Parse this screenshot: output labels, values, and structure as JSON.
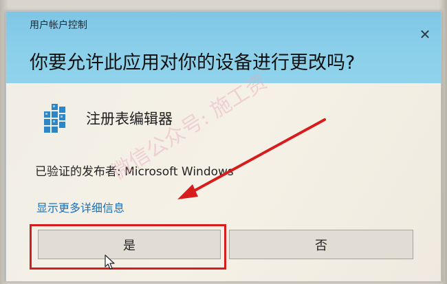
{
  "dialog": {
    "uac_title": "用户帐户控制",
    "close_symbol": "✕",
    "question": "你要允许此应用对你的设备进行更改吗?",
    "app_name": "注册表编辑器",
    "publisher": "已验证的发布者: Microsoft Windows",
    "details_link": "显示更多详细信息",
    "yes_label": "是",
    "no_label": "否"
  },
  "watermark": {
    "text": "微信公众号: 施工资"
  },
  "colors": {
    "header": "#8ccfe9",
    "body": "#f3efe6",
    "link": "#1d6fb8",
    "highlight": "#d61c1c"
  },
  "icons": {
    "app": "registry-editor-icon",
    "close": "close-icon",
    "cursor": "mouse-pointer-icon"
  }
}
